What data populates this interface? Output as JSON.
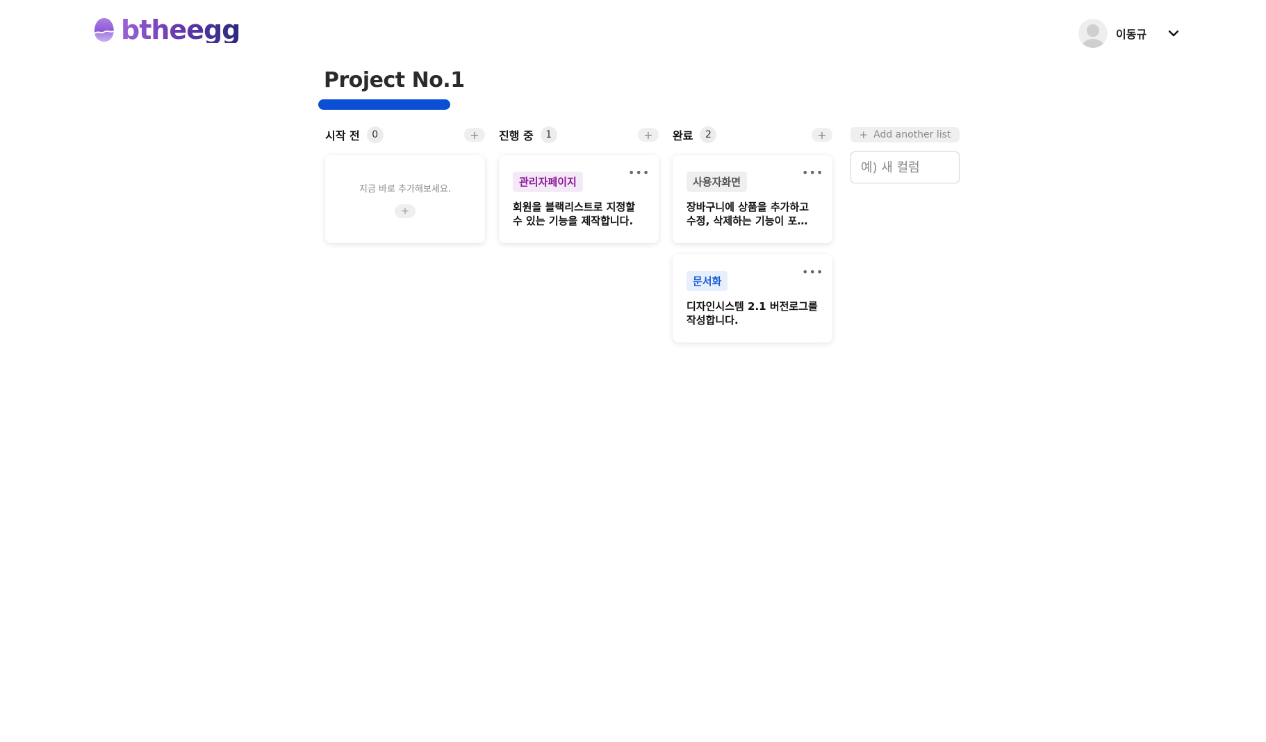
{
  "header": {
    "logo_text": "btheegg",
    "user_name": "이동규"
  },
  "project": {
    "title": "Project No.1"
  },
  "columns": [
    {
      "name": "시작 전",
      "count": "0",
      "add_label": "+",
      "empty_text": "지금 바로 추가해보세요.",
      "empty_add_label": "+"
    },
    {
      "name": "진행 중",
      "count": "1",
      "add_label": "+",
      "cards": [
        {
          "tag": "관리자페이지",
          "description": "회원을 블랙리스트로 지정할 수 있는 기능을 제작합니다."
        }
      ]
    },
    {
      "name": "완료",
      "count": "2",
      "add_label": "+",
      "cards": [
        {
          "tag": "사용자화면",
          "description": "장바구니에 상품을 추가하고 수정, 삭제하는 기능이 포…"
        },
        {
          "tag": "문서화",
          "description": "디자인시스템 2.1 버전로그를 작성합니다."
        }
      ]
    }
  ],
  "add_list": {
    "button_label": "Add another list",
    "input_placeholder": "예) 새 컬럼"
  },
  "colors": {
    "accent": "#0a4fd6",
    "tag_admin": "#8a1596",
    "tag_user_screen": "#555555",
    "tag_doc": "#1a5bd8"
  },
  "icons": {
    "logo": "egg-logo-icon",
    "avatar": "user-avatar-icon",
    "chevron": "chevron-down-icon",
    "more": "more-horizontal-icon",
    "plus": "plus-icon"
  }
}
